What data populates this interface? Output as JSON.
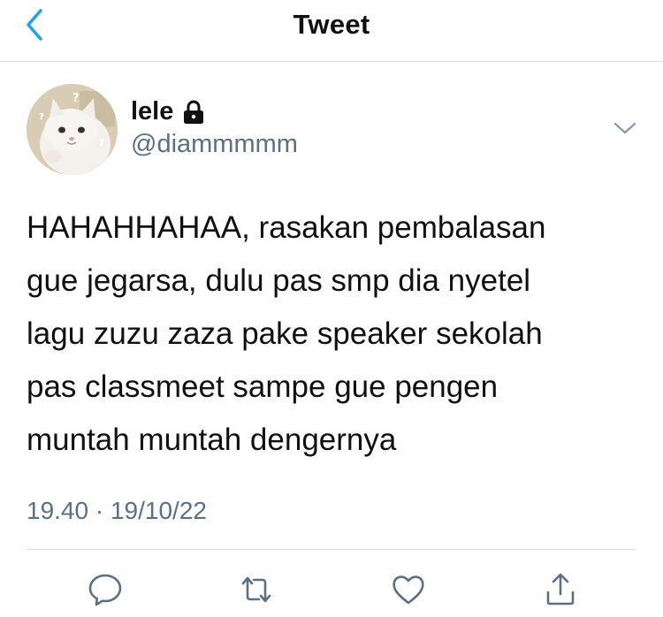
{
  "header": {
    "title": "Tweet",
    "back_icon": "chevron-left-icon",
    "accent_color": "#1da1f2"
  },
  "author": {
    "display_name": "lele",
    "handle": "@diammmmm",
    "protected_icon": "lock-icon"
  },
  "tweet": {
    "text": "HAHAHHAHAA, rasakan pembalasan\ngue jegarsa, dulu pas smp dia nyetel\nlagu zuzu zaza pake speaker sekolah\npas classmeet sampe gue pengen\nmuntah muntah dengernya",
    "time": "19.40",
    "separator": "·",
    "date": "19/10/22"
  },
  "actions": [
    {
      "icon": "reply-icon"
    },
    {
      "icon": "retweet-icon"
    },
    {
      "icon": "like-icon"
    },
    {
      "icon": "share-icon"
    }
  ]
}
